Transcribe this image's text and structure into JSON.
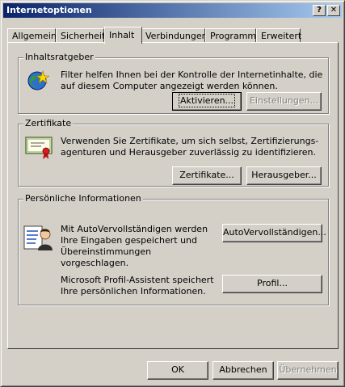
{
  "window": {
    "title": "Internetoptionen",
    "help_glyph": "?",
    "close_glyph": "✕"
  },
  "tabs": [
    {
      "label": "Allgemein"
    },
    {
      "label": "Sicherheit"
    },
    {
      "label": "Inhalt",
      "active": true
    },
    {
      "label": "Verbindungen"
    },
    {
      "label": "Programme"
    },
    {
      "label": "Erweitert"
    }
  ],
  "content_advisor": {
    "title": "Inhaltsratgeber",
    "description": "Filter helfen Ihnen bei der Kontrolle der Internetinhalte, die auf diesem Computer angezeigt werden können.",
    "enable_button": "Aktivieren...",
    "settings_button": "Einstellungen..."
  },
  "certificates": {
    "title": "Zertifikate",
    "description": "Verwenden Sie Zertifikate, um sich selbst, Zertifizierungs-agenturen und Herausgeber zuverlässig zu identifizieren.",
    "certificates_button": "Zertifikate...",
    "publishers_button": "Herausgeber..."
  },
  "personal_info": {
    "title": "Persönliche Informationen",
    "autocomplete_text": "Mit AutoVervollständigen werden Ihre Eingaben gespeichert und Übereinstimmungen vorgeschlagen.",
    "autocomplete_button": "AutoVervollständigen...",
    "profile_text": "Microsoft Profil-Assistent speichert Ihre persönlichen Informationen.",
    "profile_button": "Profil..."
  },
  "dialog_buttons": {
    "ok": "OK",
    "cancel": "Abbrechen",
    "apply": "Übernehmen"
  }
}
